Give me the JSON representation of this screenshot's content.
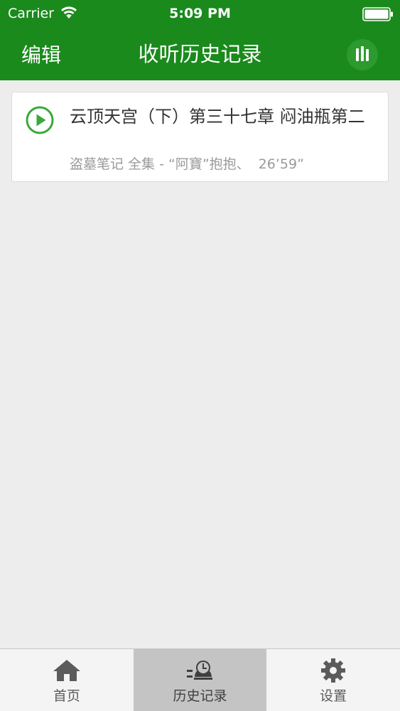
{
  "status_bar": {
    "carrier": "Carrier",
    "time": "5:09 PM",
    "wifi_icon": "wifi-icon",
    "battery_icon": "battery-icon"
  },
  "nav": {
    "edit_label": "编辑",
    "title": "收听历史记录",
    "now_playing_icon": "equalizer-bars-icon",
    "color": "#1a8a1c"
  },
  "history": {
    "items": [
      {
        "icon": "play-circle-icon",
        "title": "云顶天宫（下）第三十七章 闷油瓶第二",
        "album": "盗墓笔记 全集 - “阿寶”抱抱、",
        "duration": "26’59”"
      }
    ]
  },
  "tab_bar": {
    "tabs": [
      {
        "label": "首页",
        "icon": "home-icon",
        "active": false
      },
      {
        "label": "历史记录",
        "icon": "history-icon",
        "active": true
      },
      {
        "label": "设置",
        "icon": "gear-icon",
        "active": false
      }
    ]
  },
  "colors": {
    "accent": "#1a8a1c",
    "play_icon": "#3aa83c",
    "background": "#ededed"
  }
}
